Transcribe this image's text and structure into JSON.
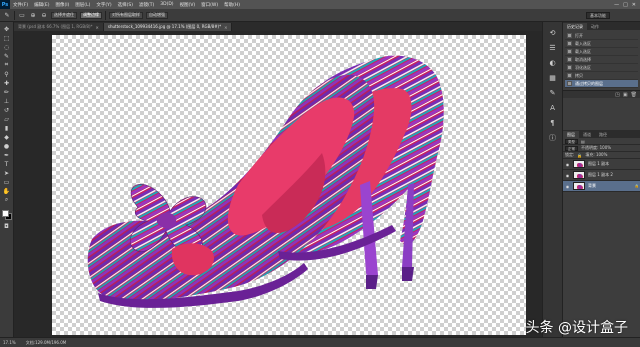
{
  "app": {
    "logo": "Ps"
  },
  "menu": [
    "文件(F)",
    "编辑(E)",
    "图像(I)",
    "图层(L)",
    "文字(Y)",
    "选择(S)",
    "滤镜(T)",
    "3D(D)",
    "视图(V)",
    "窗口(W)",
    "帮助(H)"
  ],
  "window_controls": [
    "—",
    "□",
    "✕"
  ],
  "options": {
    "select_subject": "选择并遮住",
    "refine": "调整边缘",
    "sample": "对所有图层取样",
    "auto_enhance": "自动增强",
    "workspace": "基本功能"
  },
  "tabs": [
    {
      "label": "背景 (psd 副本 66.7% (图层 1, RGB/8)*",
      "active": false
    },
    {
      "label": "shutterstock_109934416.jpg @ 17.1% (图层 0, RGB/8#)*",
      "active": true
    }
  ],
  "history": {
    "tabs": [
      "历史记录",
      "动作"
    ],
    "items": [
      {
        "label": "打开",
        "selected": false
      },
      {
        "label": "载入选区",
        "selected": false
      },
      {
        "label": "载入选区",
        "selected": false
      },
      {
        "label": "取消选择",
        "selected": false
      },
      {
        "label": "羽化选区",
        "selected": false
      },
      {
        "label": "拷贝",
        "selected": false
      },
      {
        "label": "通过拷贝的图层",
        "selected": true
      }
    ]
  },
  "layers": {
    "tabs": [
      "图层",
      "通道",
      "路径"
    ],
    "kind_label": "类型",
    "blend": "正常",
    "opacity_label": "不透明度: 100%",
    "lock_label": "锁定:",
    "fill_label": "填充: 100%",
    "rows": [
      {
        "name": "图层 1 副本",
        "selected": false,
        "fx": ""
      },
      {
        "name": "图层 1 副本 2",
        "selected": false,
        "fx": ""
      },
      {
        "name": "背景",
        "selected": true,
        "fx": "🔒"
      }
    ]
  },
  "status": {
    "zoom": "17.1%",
    "doc": "文档:129.0M/196.0M"
  },
  "watermark": "头条 @设计盒子",
  "colors": {
    "accent": "#5a6f8c",
    "panel": "#3d3d3d"
  }
}
